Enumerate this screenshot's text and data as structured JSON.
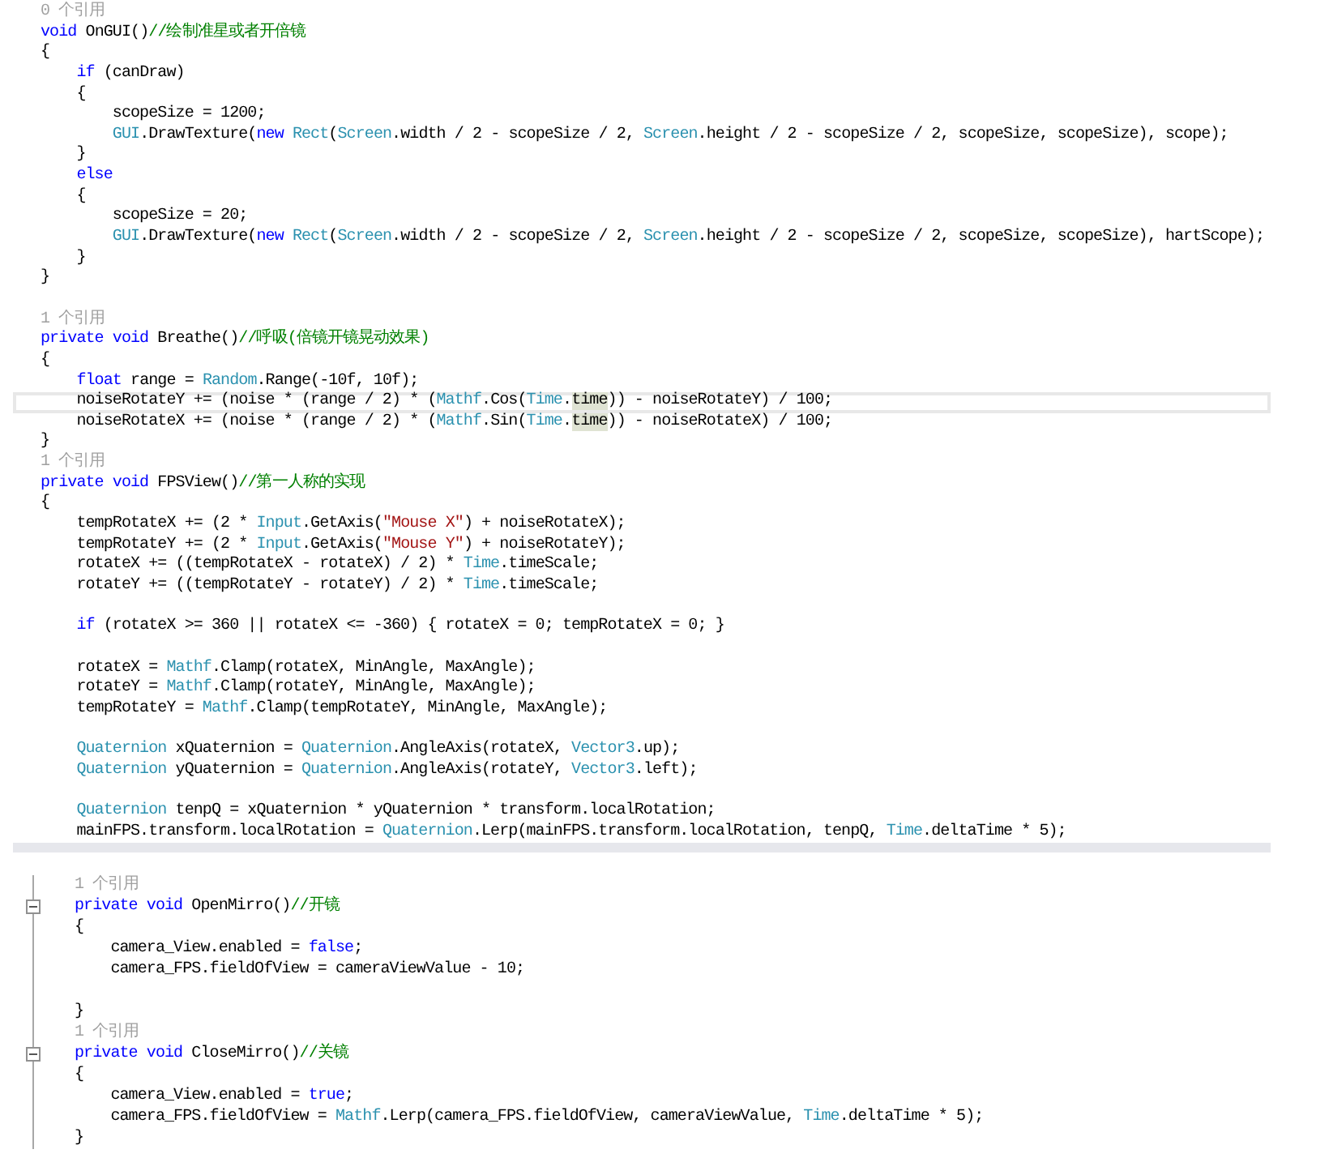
{
  "panes": [
    {
      "kind": "top",
      "lines": [
        {
          "kind": "lens",
          "segments": [
            {
              "kind": "plain",
              "text": "0 个引用"
            }
          ]
        },
        {
          "kind": "code",
          "segments": [
            {
              "kind": "keyword",
              "text": "void"
            },
            {
              "kind": "plain",
              "text": " OnGUI()"
            },
            {
              "kind": "comment",
              "text": "//绘制准星或者开倍镜"
            }
          ]
        },
        {
          "kind": "code",
          "segments": [
            {
              "kind": "plain",
              "text": "{"
            }
          ]
        },
        {
          "kind": "code",
          "segments": [
            {
              "kind": "keyword",
              "text": "    if"
            },
            {
              "kind": "plain",
              "text": " (canDraw)"
            }
          ]
        },
        {
          "kind": "code",
          "segments": [
            {
              "kind": "plain",
              "text": "    {"
            }
          ]
        },
        {
          "kind": "code",
          "segments": [
            {
              "kind": "plain",
              "text": "        scopeSize = 1200;"
            }
          ]
        },
        {
          "kind": "code",
          "segments": [
            {
              "kind": "type",
              "text": "        GUI"
            },
            {
              "kind": "plain",
              "text": ".DrawTexture("
            },
            {
              "kind": "keyword",
              "text": "new "
            },
            {
              "kind": "type",
              "text": "Rect"
            },
            {
              "kind": "plain",
              "text": "("
            },
            {
              "kind": "type",
              "text": "Screen"
            },
            {
              "kind": "plain",
              "text": ".width / 2 - scopeSize / 2, "
            },
            {
              "kind": "type",
              "text": "Screen"
            },
            {
              "kind": "plain",
              "text": ".height / 2 - scopeSize / 2, scopeSize, scopeSize), scope);"
            }
          ]
        },
        {
          "kind": "code",
          "segments": [
            {
              "kind": "plain",
              "text": "    }"
            }
          ]
        },
        {
          "kind": "code",
          "segments": [
            {
              "kind": "keyword",
              "text": "    else"
            }
          ]
        },
        {
          "kind": "code",
          "segments": [
            {
              "kind": "plain",
              "text": "    {"
            }
          ]
        },
        {
          "kind": "code",
          "segments": [
            {
              "kind": "plain",
              "text": "        scopeSize = 20;"
            }
          ]
        },
        {
          "kind": "code",
          "segments": [
            {
              "kind": "type",
              "text": "        GUI"
            },
            {
              "kind": "plain",
              "text": ".DrawTexture("
            },
            {
              "kind": "keyword",
              "text": "new "
            },
            {
              "kind": "type",
              "text": "Rect"
            },
            {
              "kind": "plain",
              "text": "("
            },
            {
              "kind": "type",
              "text": "Screen"
            },
            {
              "kind": "plain",
              "text": ".width / 2 - scopeSize / 2, "
            },
            {
              "kind": "type",
              "text": "Screen"
            },
            {
              "kind": "plain",
              "text": ".height / 2 - scopeSize / 2, scopeSize, scopeSize), hartScope);"
            }
          ]
        },
        {
          "kind": "code",
          "segments": [
            {
              "kind": "plain",
              "text": "    }"
            }
          ]
        },
        {
          "kind": "code",
          "segments": [
            {
              "kind": "plain",
              "text": "}"
            }
          ]
        },
        {
          "kind": "blank"
        },
        {
          "kind": "lens",
          "segments": [
            {
              "kind": "plain",
              "text": "1 个引用"
            }
          ]
        },
        {
          "kind": "code",
          "segments": [
            {
              "kind": "keyword",
              "text": "private void"
            },
            {
              "kind": "plain",
              "text": " Breathe()"
            },
            {
              "kind": "comment",
              "text": "//呼吸(倍镜开镜晃动效果)"
            }
          ]
        },
        {
          "kind": "code",
          "segments": [
            {
              "kind": "plain",
              "text": "{"
            }
          ]
        },
        {
          "kind": "code",
          "segments": [
            {
              "kind": "keyword",
              "text": "    float"
            },
            {
              "kind": "plain",
              "text": " range = "
            },
            {
              "kind": "type",
              "text": "Random"
            },
            {
              "kind": "plain",
              "text": ".Range(-10f, 10f);"
            }
          ]
        },
        {
          "kind": "current",
          "segments": [
            {
              "kind": "plain",
              "text": "    noiseRotateY += (noise * (range / 2) * ("
            },
            {
              "kind": "type",
              "text": "Mathf"
            },
            {
              "kind": "plain",
              "text": ".Cos("
            },
            {
              "kind": "type",
              "text": "Time"
            },
            {
              "kind": "plain",
              "text": "."
            },
            {
              "kind": "match",
              "text": "time"
            },
            {
              "kind": "plain",
              "text": ")) - noiseRotateY) / 100;"
            }
          ]
        },
        {
          "kind": "code",
          "segments": [
            {
              "kind": "plain",
              "text": "    noiseRotateX += (noise * (range / 2) * ("
            },
            {
              "kind": "type",
              "text": "Mathf"
            },
            {
              "kind": "plain",
              "text": ".Sin("
            },
            {
              "kind": "type",
              "text": "Time"
            },
            {
              "kind": "plain",
              "text": "."
            },
            {
              "kind": "match",
              "text": "time"
            },
            {
              "kind": "plain",
              "text": ")) - noiseRotateX) / 100;"
            }
          ]
        },
        {
          "kind": "code",
          "segments": [
            {
              "kind": "plain",
              "text": "}"
            }
          ]
        },
        {
          "kind": "lens",
          "segments": [
            {
              "kind": "plain",
              "text": "1 个引用"
            }
          ]
        },
        {
          "kind": "code",
          "segments": [
            {
              "kind": "keyword",
              "text": "private void"
            },
            {
              "kind": "plain",
              "text": " FPSView()"
            },
            {
              "kind": "comment",
              "text": "//第一人称的实现"
            }
          ]
        },
        {
          "kind": "code",
          "segments": [
            {
              "kind": "plain",
              "text": "{"
            }
          ]
        },
        {
          "kind": "code",
          "segments": [
            {
              "kind": "plain",
              "text": "    tempRotateX += (2 * "
            },
            {
              "kind": "type",
              "text": "Input"
            },
            {
              "kind": "plain",
              "text": ".GetAxis("
            },
            {
              "kind": "string",
              "text": "\"Mouse X\""
            },
            {
              "kind": "plain",
              "text": ") + noiseRotateX);"
            }
          ]
        },
        {
          "kind": "code",
          "segments": [
            {
              "kind": "plain",
              "text": "    tempRotateY += (2 * "
            },
            {
              "kind": "type",
              "text": "Input"
            },
            {
              "kind": "plain",
              "text": ".GetAxis("
            },
            {
              "kind": "string",
              "text": "\"Mouse Y\""
            },
            {
              "kind": "plain",
              "text": ") + noiseRotateY);"
            }
          ]
        },
        {
          "kind": "code",
          "segments": [
            {
              "kind": "plain",
              "text": "    rotateX += ((tempRotateX - rotateX) / 2) * "
            },
            {
              "kind": "type",
              "text": "Time"
            },
            {
              "kind": "plain",
              "text": ".timeScale;"
            }
          ]
        },
        {
          "kind": "code",
          "segments": [
            {
              "kind": "plain",
              "text": "    rotateY += ((tempRotateY - rotateY) / 2) * "
            },
            {
              "kind": "type",
              "text": "Time"
            },
            {
              "kind": "plain",
              "text": ".timeScale;"
            }
          ]
        },
        {
          "kind": "blank"
        },
        {
          "kind": "code",
          "segments": [
            {
              "kind": "keyword",
              "text": "    if"
            },
            {
              "kind": "plain",
              "text": " (rotateX >= 360 || rotateX <= -360) { rotateX = 0; tempRotateX = 0; }"
            }
          ]
        },
        {
          "kind": "blank"
        },
        {
          "kind": "code",
          "segments": [
            {
              "kind": "plain",
              "text": "    rotateX = "
            },
            {
              "kind": "type",
              "text": "Mathf"
            },
            {
              "kind": "plain",
              "text": ".Clamp(rotateX, MinAngle, MaxAngle);"
            }
          ]
        },
        {
          "kind": "code",
          "segments": [
            {
              "kind": "plain",
              "text": "    rotateY = "
            },
            {
              "kind": "type",
              "text": "Mathf"
            },
            {
              "kind": "plain",
              "text": ".Clamp(rotateY, MinAngle, MaxAngle);"
            }
          ]
        },
        {
          "kind": "code",
          "segments": [
            {
              "kind": "plain",
              "text": "    tempRotateY = "
            },
            {
              "kind": "type",
              "text": "Mathf"
            },
            {
              "kind": "plain",
              "text": ".Clamp(tempRotateY, MinAngle, MaxAngle);"
            }
          ]
        },
        {
          "kind": "blank"
        },
        {
          "kind": "code",
          "segments": [
            {
              "kind": "type",
              "text": "    Quaternion"
            },
            {
              "kind": "plain",
              "text": " xQuaternion = "
            },
            {
              "kind": "type",
              "text": "Quaternion"
            },
            {
              "kind": "plain",
              "text": ".AngleAxis(rotateX, "
            },
            {
              "kind": "type",
              "text": "Vector3"
            },
            {
              "kind": "plain",
              "text": ".up);"
            }
          ]
        },
        {
          "kind": "code",
          "segments": [
            {
              "kind": "type",
              "text": "    Quaternion"
            },
            {
              "kind": "plain",
              "text": " yQuaternion = "
            },
            {
              "kind": "type",
              "text": "Quaternion"
            },
            {
              "kind": "plain",
              "text": ".AngleAxis(rotateY, "
            },
            {
              "kind": "type",
              "text": "Vector3"
            },
            {
              "kind": "plain",
              "text": ".left);"
            }
          ]
        },
        {
          "kind": "blank"
        },
        {
          "kind": "code",
          "segments": [
            {
              "kind": "type",
              "text": "    Quaternion"
            },
            {
              "kind": "plain",
              "text": " tenpQ = xQuaternion * yQuaternion * transform.localRotation;"
            }
          ]
        },
        {
          "kind": "code",
          "segments": [
            {
              "kind": "plain",
              "text": "    mainFPS.transform.localRotation = "
            },
            {
              "kind": "type",
              "text": "Quaternion"
            },
            {
              "kind": "plain",
              "text": ".Lerp(mainFPS.transform.localRotation, tenpQ, "
            },
            {
              "kind": "type",
              "text": "Time"
            },
            {
              "kind": "plain",
              "text": ".deltaTime * 5);"
            }
          ]
        }
      ]
    },
    {
      "kind": "outlined",
      "lines": [
        {
          "kind": "lens",
          "segments": [
            {
              "kind": "plain",
              "text": "1 个引用"
            }
          ]
        },
        {
          "kind": "header",
          "segments": [
            {
              "kind": "keyword",
              "text": "private void"
            },
            {
              "kind": "plain",
              "text": " OpenMirro()"
            },
            {
              "kind": "comment",
              "text": "//开镜"
            }
          ]
        },
        {
          "kind": "code",
          "segments": [
            {
              "kind": "plain",
              "text": "{"
            }
          ]
        },
        {
          "kind": "code",
          "segments": [
            {
              "kind": "plain",
              "text": "    camera_View.enabled = "
            },
            {
              "kind": "keyword",
              "text": "false"
            },
            {
              "kind": "plain",
              "text": ";"
            }
          ]
        },
        {
          "kind": "code",
          "segments": [
            {
              "kind": "plain",
              "text": "    camera_FPS.fieldOfView = cameraViewValue - 10;"
            }
          ]
        },
        {
          "kind": "blank"
        },
        {
          "kind": "code",
          "segments": [
            {
              "kind": "plain",
              "text": "}"
            }
          ]
        },
        {
          "kind": "lens",
          "segments": [
            {
              "kind": "plain",
              "text": "1 个引用"
            }
          ]
        },
        {
          "kind": "header",
          "segments": [
            {
              "kind": "keyword",
              "text": "private void"
            },
            {
              "kind": "plain",
              "text": " CloseMirro()"
            },
            {
              "kind": "comment",
              "text": "//关镜"
            }
          ]
        },
        {
          "kind": "code",
          "segments": [
            {
              "kind": "plain",
              "text": "{"
            }
          ]
        },
        {
          "kind": "code",
          "segments": [
            {
              "kind": "plain",
              "text": "    camera_View.enabled = "
            },
            {
              "kind": "keyword",
              "text": "true"
            },
            {
              "kind": "plain",
              "text": ";"
            }
          ]
        },
        {
          "kind": "code",
          "segments": [
            {
              "kind": "plain",
              "text": "    camera_FPS.fieldOfView = "
            },
            {
              "kind": "type",
              "text": "Mathf"
            },
            {
              "kind": "plain",
              "text": ".Lerp(camera_FPS.fieldOfView, cameraViewValue, "
            },
            {
              "kind": "type",
              "text": "Time"
            },
            {
              "kind": "plain",
              "text": ".deltaTime * 5);"
            }
          ]
        },
        {
          "kind": "code",
          "segments": [
            {
              "kind": "plain",
              "text": "}"
            }
          ]
        }
      ]
    }
  ]
}
